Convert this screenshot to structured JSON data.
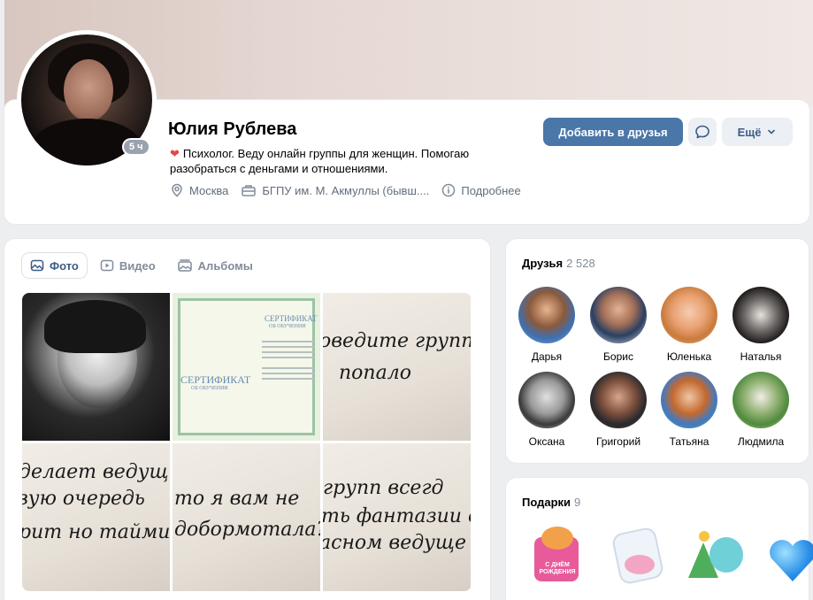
{
  "profile": {
    "name": "Юлия Рублева",
    "status": "Психолог. Веду онлайн группы для женщин. Помогаю разобраться с деньгами и отношениями.",
    "online_badge": "5 ч",
    "info": {
      "city": "Москва",
      "education": "БГПУ им. М. Акмуллы (бывш....",
      "more": "Подробнее"
    }
  },
  "actions": {
    "add_friend": "Добавить в друзья",
    "more": "Ещё"
  },
  "media": {
    "tabs": [
      {
        "label": "Фото",
        "icon": "photo-icon",
        "active": true
      },
      {
        "label": "Видео",
        "icon": "video-icon",
        "active": false
      },
      {
        "label": "Альбомы",
        "icon": "albums-icon",
        "active": false
      }
    ],
    "photos": {
      "p2_title": "СЕРТИФИКАТ",
      "p2_sub": "ОБ ОБУЧЕНИИ",
      "p3": [
        "оведите групп",
        "попало"
      ],
      "p4": [
        "делает ведущ",
        "вую очередь",
        "рит но таймин"
      ],
      "p5": [
        "то я вам не",
        "добормотала?"
      ],
      "p6": [
        "групп всегд",
        "ть фантазии о",
        "асном ведуще"
      ]
    }
  },
  "friends": {
    "title": "Друзья",
    "count": "2 528",
    "list": [
      {
        "name": "Дарья"
      },
      {
        "name": "Борис"
      },
      {
        "name": "Юленька"
      },
      {
        "name": "Наталья"
      },
      {
        "name": "Оксана"
      },
      {
        "name": "Григорий"
      },
      {
        "name": "Татьяна"
      },
      {
        "name": "Людмила"
      }
    ]
  },
  "gifts": {
    "title": "Подарки",
    "count": "9",
    "gift1_text": "С ДНЁМ РОЖДЕНИЯ"
  },
  "colors": {
    "accent": "#4a76a8",
    "link": "#3b5d88",
    "muted": "#818c99",
    "background": "#edeef0"
  }
}
